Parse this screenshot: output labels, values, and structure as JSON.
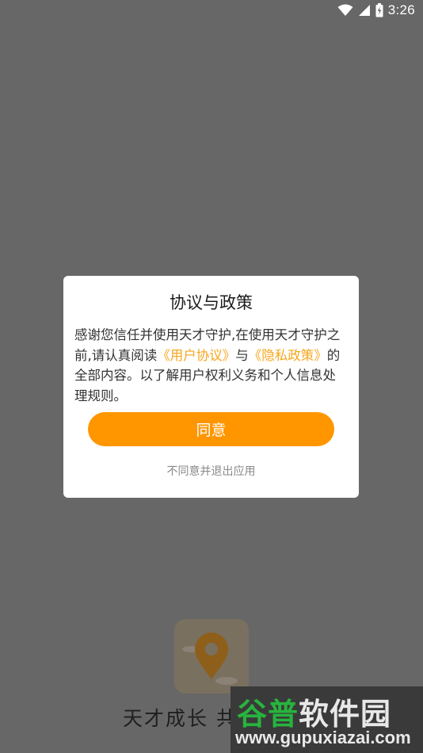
{
  "status_bar": {
    "time": "3:26",
    "icons": [
      "wifi-icon",
      "signal-icon",
      "battery-charging-icon"
    ]
  },
  "dialog": {
    "title": "协议与政策",
    "body_prefix": "感谢您信任并使用天才守护,在使用天才守护之前,请认真阅读",
    "user_agreement_link": "《用户协议》",
    "conjunction": "与",
    "privacy_policy_link": "《隐私政策》",
    "body_suffix": "的全部内容。以了解用户权利义务和个人信息处理规则。",
    "agree_label": "同意",
    "disagree_label": "不同意并退出应用"
  },
  "splash": {
    "app_title": "天才成长 共"
  },
  "watermark": {
    "name_green": "谷普",
    "name_white": "软件园",
    "url": "www.gupuxiazai.com"
  },
  "colors": {
    "accent": "#ff9600",
    "link": "#f7a51c",
    "overlay": "#676767"
  }
}
